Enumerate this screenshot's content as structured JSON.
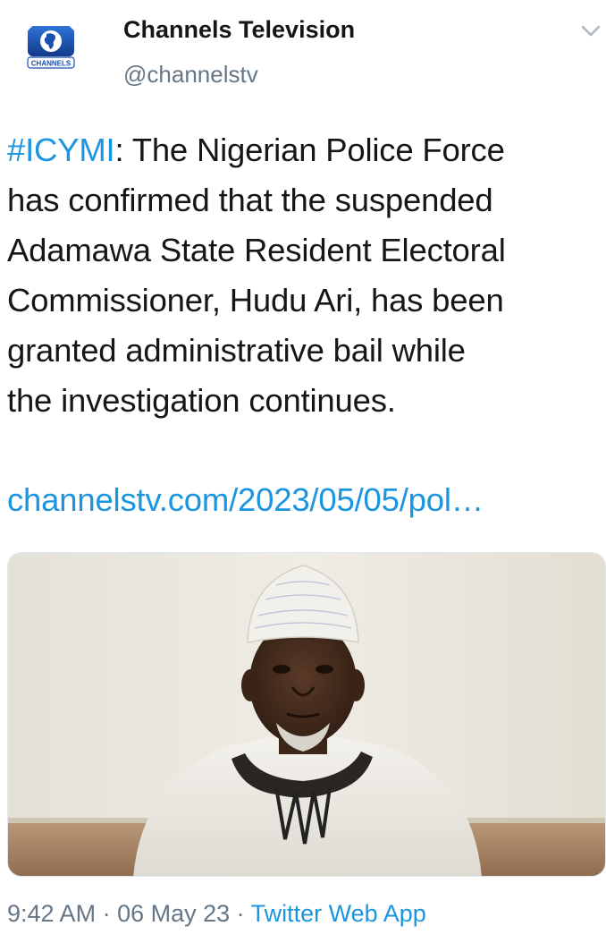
{
  "author": {
    "name": "Channels Television",
    "handle": "@channelstv",
    "avatar_label": "CHANNELS",
    "avatar_icon": "channels-logo-icon"
  },
  "menu": {
    "icon": "chevron-down-icon"
  },
  "tweet": {
    "hashtag": "#ICYMI",
    "lines": [
      ": The Nigerian Police Force",
      "has confirmed that the suspended",
      "Adamawa State Resident Electoral",
      "Commissioner, Hudu Ari, has been",
      "granted administrative bail while",
      "the investigation continues."
    ],
    "link": "channelstv.com/2023/05/05/pol…"
  },
  "meta": {
    "time": "9:42 AM",
    "separator": " · ",
    "date": "06 May 23",
    "source": "Twitter Web App"
  },
  "colors": {
    "link": "#1b95e0",
    "secondary_text": "#657786",
    "primary_text": "#14171a"
  }
}
